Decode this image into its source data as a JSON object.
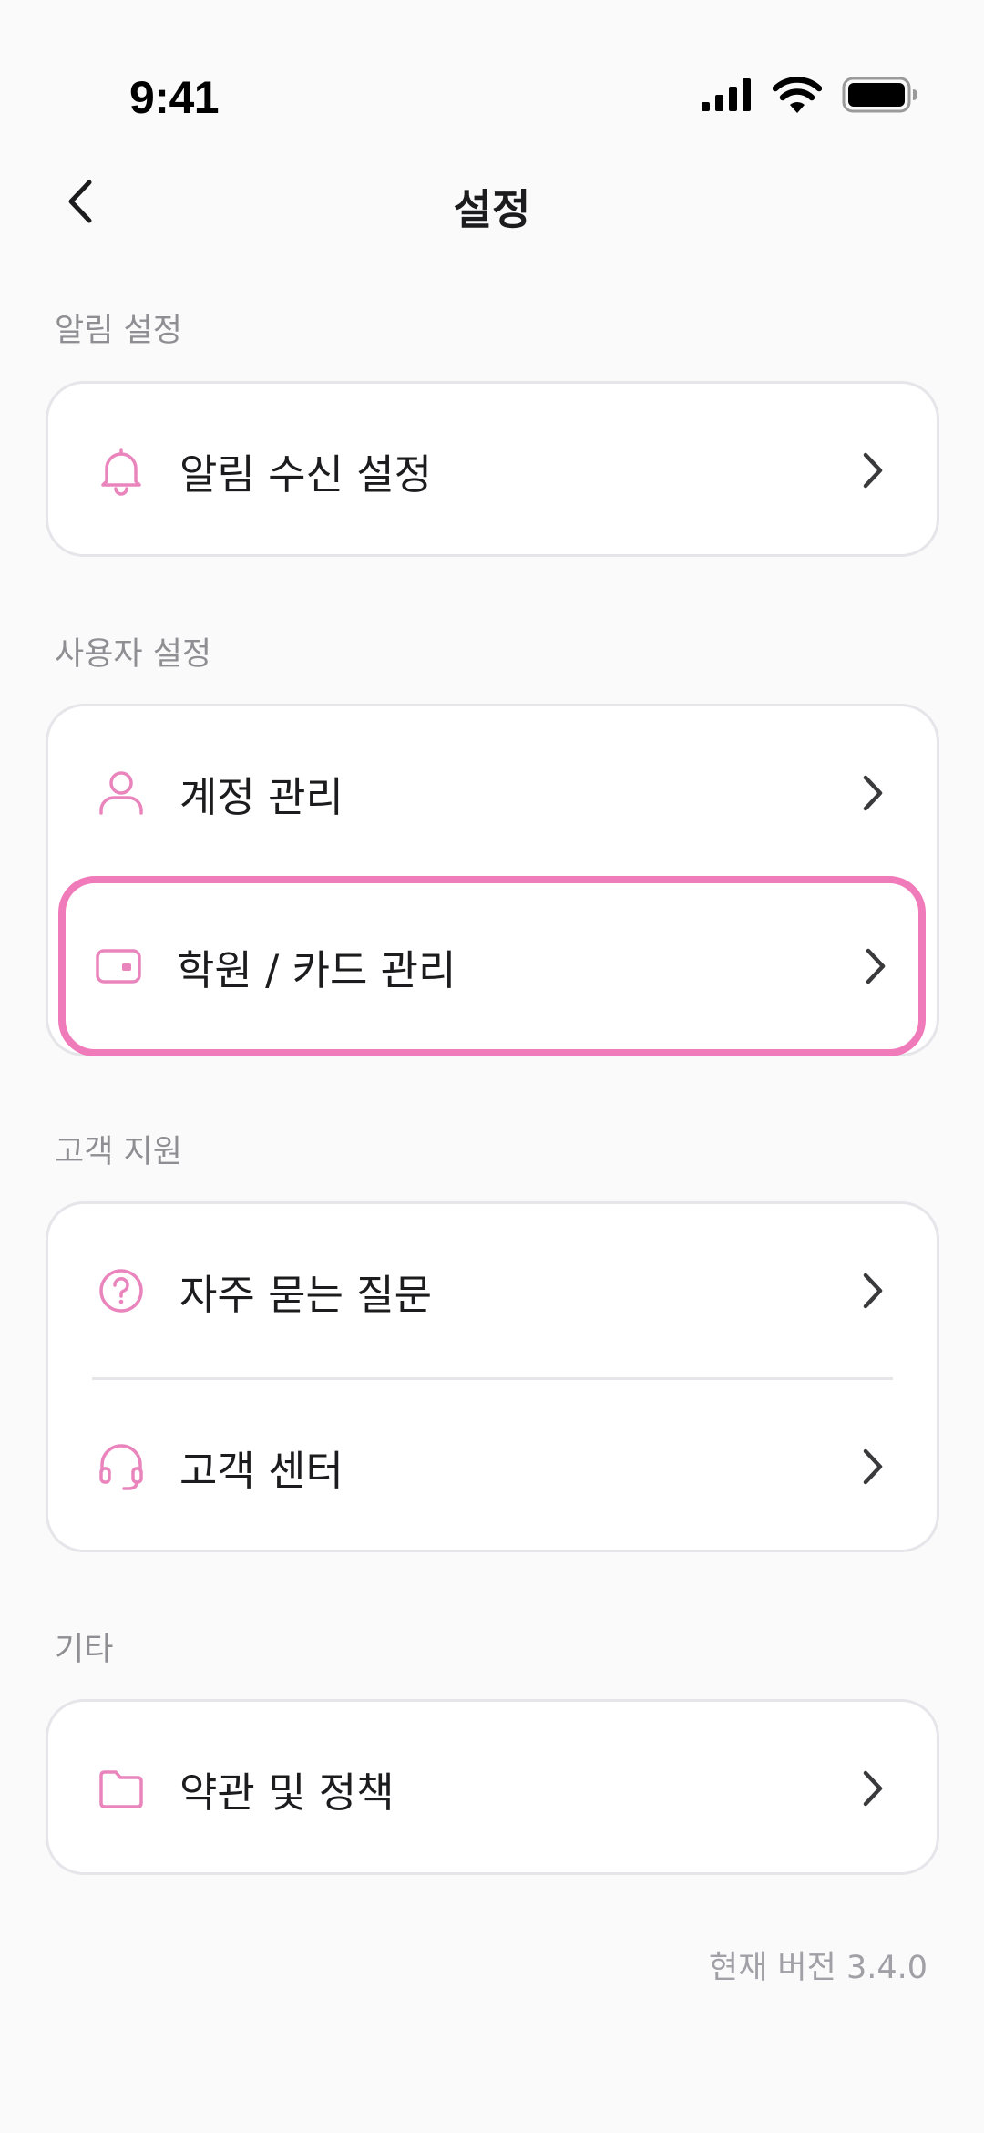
{
  "status_bar": {
    "time": "9:41",
    "icons": [
      "cellular-signal-icon",
      "wifi-icon",
      "battery-icon"
    ]
  },
  "nav": {
    "title": "설정",
    "back_icon": "chevron-left-icon"
  },
  "sections": {
    "notifications": {
      "label": "알림 설정",
      "items": [
        {
          "label": "알림 수신 설정",
          "icon": "bell-icon"
        }
      ]
    },
    "user": {
      "label": "사용자 설정",
      "items": [
        {
          "label": "계정 관리",
          "icon": "person-icon"
        },
        {
          "label": "학원 / 카드 관리",
          "icon": "wallet-icon",
          "highlighted": true
        }
      ]
    },
    "support": {
      "label": "고객 지원",
      "items": [
        {
          "label": "자주 묻는 질문",
          "icon": "question-circle-icon"
        },
        {
          "label": "고객 센터",
          "icon": "headset-icon"
        }
      ]
    },
    "etc": {
      "label": "기타",
      "items": [
        {
          "label": "약관 및 정책",
          "icon": "folder-icon"
        }
      ]
    }
  },
  "footer": {
    "version_text": "현재 버전 3.4.0"
  },
  "colors": {
    "accent": "#F07BBB",
    "icon": "#E985BC",
    "text": "#1C1C1E",
    "secondary_text": "#8E8E93",
    "card_border": "#E5E5EA",
    "background": "#FAFAFA"
  }
}
